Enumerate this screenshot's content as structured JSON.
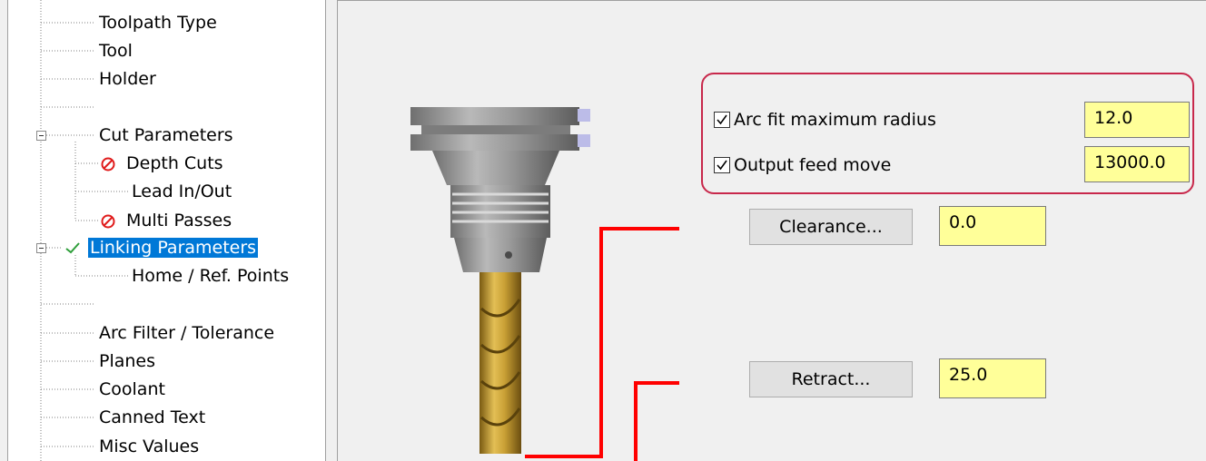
{
  "tree": {
    "items": [
      {
        "label": "Toolpath Type"
      },
      {
        "label": "Tool"
      },
      {
        "label": "Holder"
      },
      {
        "label": ""
      },
      {
        "label": "Cut Parameters"
      },
      {
        "label": "Depth Cuts"
      },
      {
        "label": "Lead In/Out"
      },
      {
        "label": "Multi Passes"
      },
      {
        "label": "Linking Parameters"
      },
      {
        "label": "Home / Ref. Points"
      },
      {
        "label": ""
      },
      {
        "label": "Arc Filter / Tolerance"
      },
      {
        "label": "Planes"
      },
      {
        "label": "Coolant"
      },
      {
        "label": "Canned Text"
      },
      {
        "label": "Misc Values"
      }
    ]
  },
  "panel": {
    "arc_fit": {
      "label": "Arc fit maximum radius",
      "checked": true,
      "value": "12.0"
    },
    "output_feed": {
      "label": "Output feed move",
      "checked": true,
      "value": "13000.0"
    },
    "clearance": {
      "label": "Clearance...",
      "value": "0.0"
    },
    "retract": {
      "label": "Retract...",
      "value": "25.0"
    }
  },
  "colors": {
    "selection": "#0078d7",
    "field_bg": "#ffff99",
    "highlight_border": "#c8284b",
    "indicator_line": "#ff0000",
    "disabled_icon": "#e01b1b",
    "check_icon": "#2e9e3a",
    "tool_flute": "#c9a035"
  }
}
